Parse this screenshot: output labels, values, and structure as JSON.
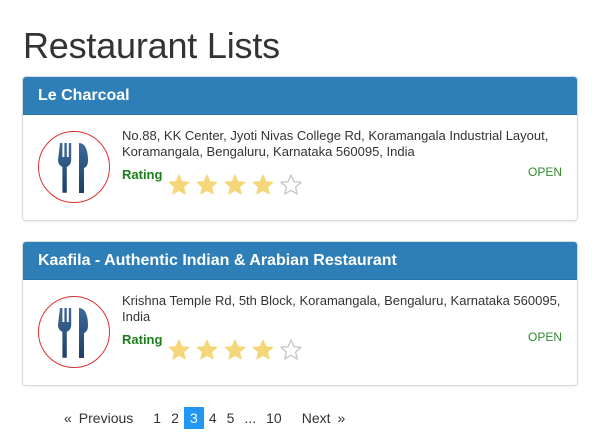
{
  "page": {
    "title": "Restaurant Lists"
  },
  "restaurants": [
    {
      "name": "Le Charcoal",
      "address": "No.88, KK Center, Jyoti Nivas College Rd, Koramangala Industrial Layout, Koramangala, Bengaluru, Karnataka 560095, India",
      "rating_label": "Rating",
      "rating": 4,
      "rating_max": 5,
      "status": "OPEN",
      "icon": "fork-knife-icon"
    },
    {
      "name": "Kaafila - Authentic Indian & Arabian Restaurant",
      "address": "Krishna Temple Rd, 5th Block, Koramangala, Bengaluru, Karnataka 560095, India",
      "rating_label": "Rating",
      "rating": 4,
      "rating_max": 5,
      "status": "OPEN",
      "icon": "fork-knife-icon"
    }
  ],
  "pagination": {
    "prev_arrow": "«",
    "prev_label": "Previous",
    "pages": [
      "1",
      "2",
      "3",
      "4",
      "5"
    ],
    "ellipsis": "...",
    "last_page": "10",
    "next_label": "Next",
    "next_arrow": "»",
    "current_page": "3"
  },
  "colors": {
    "header_bg": "#2e7fb8",
    "rating_text": "#1a7f1a",
    "status_text": "#2e8b2e",
    "star_filled": "#f5d77a",
    "star_empty": "#c8c8c8",
    "logo_border": "#e03030",
    "active_page_bg": "#2196f3"
  }
}
